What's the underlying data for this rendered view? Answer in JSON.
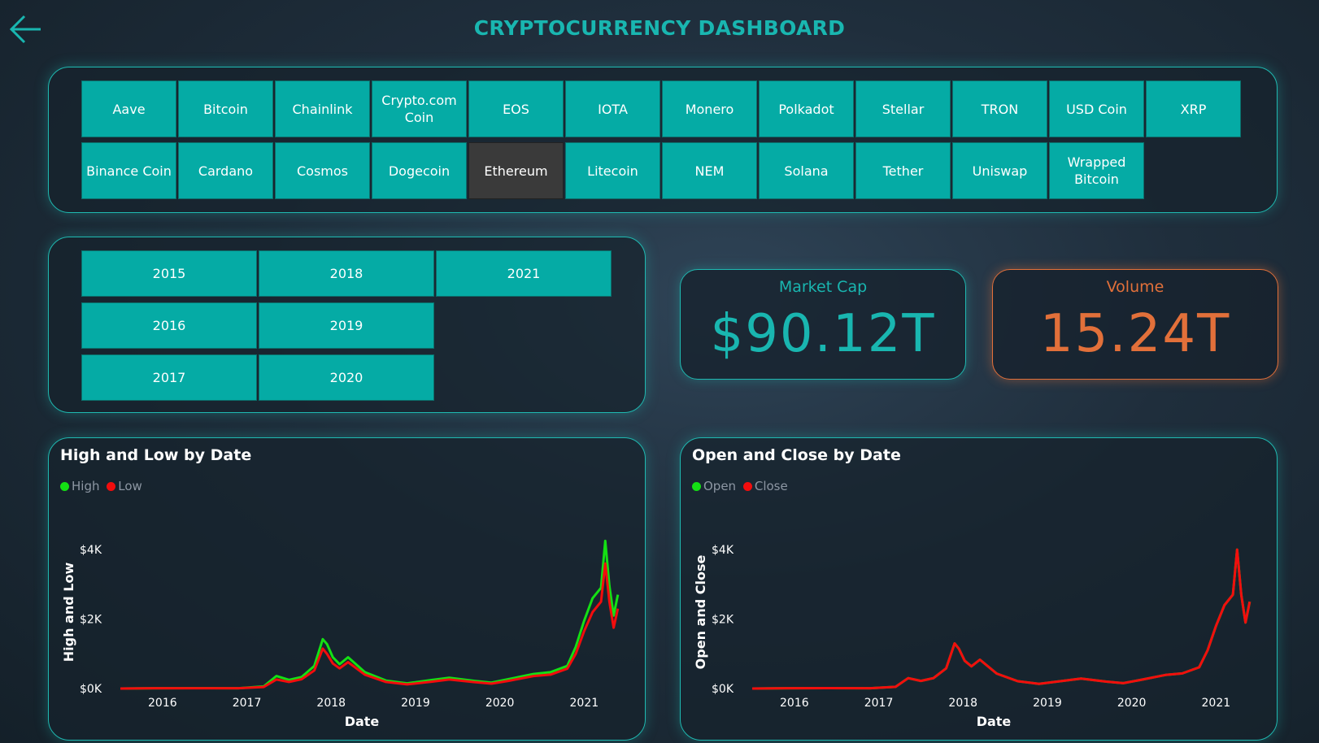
{
  "page_title": "CRYPTOCURRENCY DASHBOARD",
  "coins": {
    "row1": [
      "Aave",
      "Bitcoin",
      "Chainlink",
      "Crypto.com Coin",
      "EOS",
      "IOTA",
      "Monero",
      "Polkadot",
      "Stellar",
      "TRON",
      "USD Coin",
      "XRP"
    ],
    "row2": [
      "Binance Coin",
      "Cardano",
      "Cosmos",
      "Dogecoin",
      "Ethereum",
      "Litecoin",
      "NEM",
      "Solana",
      "Tether",
      "Uniswap",
      "Wrapped Bitcoin"
    ],
    "selected": "Ethereum"
  },
  "years": {
    "col1": [
      "2015",
      "2016",
      "2017"
    ],
    "col2": [
      "2018",
      "2019",
      "2020"
    ],
    "col3": [
      "2021"
    ]
  },
  "kpis": {
    "market_cap": {
      "label": "Market Cap",
      "value": "$90.12T",
      "color": "#19b6b0"
    },
    "volume": {
      "label": "Volume",
      "value": "15.24T",
      "color": "#e2703a"
    }
  },
  "colors": {
    "accent": "#1fb9b1",
    "tile": "#05aba5",
    "selected_tile": "#3a3a3a",
    "series_green": "#14e014",
    "series_red": "#f20d0d"
  },
  "chart_data": [
    {
      "type": "line",
      "title": "High and Low by Date",
      "xlabel": "Date",
      "ylabel": "High and Low",
      "x_ticks": [
        "2016",
        "2017",
        "2018",
        "2019",
        "2020",
        "2021"
      ],
      "y_ticks": [
        "$0K",
        "$2K",
        "$4K"
      ],
      "ylim": [
        0,
        4400
      ],
      "legend_position": "top-left",
      "series": [
        {
          "name": "High",
          "color": "#14e014",
          "x": [
            2015.6,
            2016.0,
            2016.5,
            2017.0,
            2017.3,
            2017.45,
            2017.6,
            2017.75,
            2017.9,
            2018.0,
            2018.05,
            2018.12,
            2018.2,
            2018.3,
            2018.5,
            2018.75,
            2019.0,
            2019.3,
            2019.5,
            2019.8,
            2020.0,
            2020.2,
            2020.5,
            2020.7,
            2020.9,
            2021.0,
            2021.1,
            2021.2,
            2021.3,
            2021.35,
            2021.4,
            2021.45,
            2021.5
          ],
          "values": [
            1,
            10,
            12,
            10,
            60,
            360,
            250,
            330,
            650,
            1420,
            1280,
            900,
            700,
            900,
            470,
            230,
            150,
            250,
            310,
            220,
            170,
            270,
            420,
            470,
            650,
            1200,
            1950,
            2600,
            2900,
            4250,
            2950,
            2100,
            2700
          ]
        },
        {
          "name": "Low",
          "color": "#f20d0d",
          "x": [
            2015.6,
            2016.0,
            2016.5,
            2017.0,
            2017.3,
            2017.45,
            2017.6,
            2017.75,
            2017.9,
            2018.0,
            2018.05,
            2018.12,
            2018.2,
            2018.3,
            2018.5,
            2018.75,
            2019.0,
            2019.3,
            2019.5,
            2019.8,
            2020.0,
            2020.2,
            2020.5,
            2020.7,
            2020.9,
            2021.0,
            2021.1,
            2021.2,
            2021.3,
            2021.35,
            2021.4,
            2021.45,
            2021.5
          ],
          "values": [
            1,
            9,
            10,
            9,
            45,
            260,
            190,
            270,
            520,
            1150,
            1000,
            720,
            580,
            760,
            400,
            190,
            120,
            200,
            260,
            185,
            140,
            220,
            360,
            400,
            570,
            1000,
            1650,
            2200,
            2500,
            3600,
            2500,
            1750,
            2300
          ]
        }
      ]
    },
    {
      "type": "line",
      "title": "Open and Close by Date",
      "xlabel": "Date",
      "ylabel": "Open and Close",
      "x_ticks": [
        "2016",
        "2017",
        "2018",
        "2019",
        "2020",
        "2021"
      ],
      "y_ticks": [
        "$0K",
        "$2K",
        "$4K"
      ],
      "ylim": [
        0,
        4400
      ],
      "legend_position": "top-left",
      "series": [
        {
          "name": "Open",
          "color": "#14e014",
          "x": [
            2015.6,
            2016.0,
            2016.5,
            2017.0,
            2017.3,
            2017.45,
            2017.6,
            2017.75,
            2017.9,
            2018.0,
            2018.05,
            2018.12,
            2018.2,
            2018.3,
            2018.5,
            2018.75,
            2019.0,
            2019.3,
            2019.5,
            2019.8,
            2020.0,
            2020.2,
            2020.5,
            2020.7,
            2020.9,
            2021.0,
            2021.1,
            2021.2,
            2021.3,
            2021.35,
            2021.4,
            2021.45,
            2021.5
          ],
          "values": [
            1,
            9,
            11,
            9,
            50,
            300,
            220,
            300,
            580,
            1300,
            1150,
            800,
            640,
            830,
            430,
            210,
            135,
            225,
            285,
            200,
            155,
            245,
            390,
            435,
            610,
            1100,
            1800,
            2400,
            2700,
            4000,
            2700,
            1900,
            2500
          ]
        },
        {
          "name": "Close",
          "color": "#f20d0d",
          "x": [
            2015.6,
            2016.0,
            2016.5,
            2017.0,
            2017.3,
            2017.45,
            2017.6,
            2017.75,
            2017.9,
            2018.0,
            2018.05,
            2018.12,
            2018.2,
            2018.3,
            2018.5,
            2018.75,
            2019.0,
            2019.3,
            2019.5,
            2019.8,
            2020.0,
            2020.2,
            2020.5,
            2020.7,
            2020.9,
            2021.0,
            2021.1,
            2021.2,
            2021.3,
            2021.35,
            2021.4,
            2021.45,
            2021.5
          ],
          "values": [
            1,
            9,
            11,
            9,
            50,
            300,
            220,
            300,
            580,
            1300,
            1150,
            800,
            640,
            830,
            430,
            210,
            135,
            225,
            285,
            200,
            155,
            245,
            390,
            435,
            610,
            1100,
            1800,
            2400,
            2700,
            4000,
            2700,
            1900,
            2500
          ]
        }
      ]
    }
  ]
}
